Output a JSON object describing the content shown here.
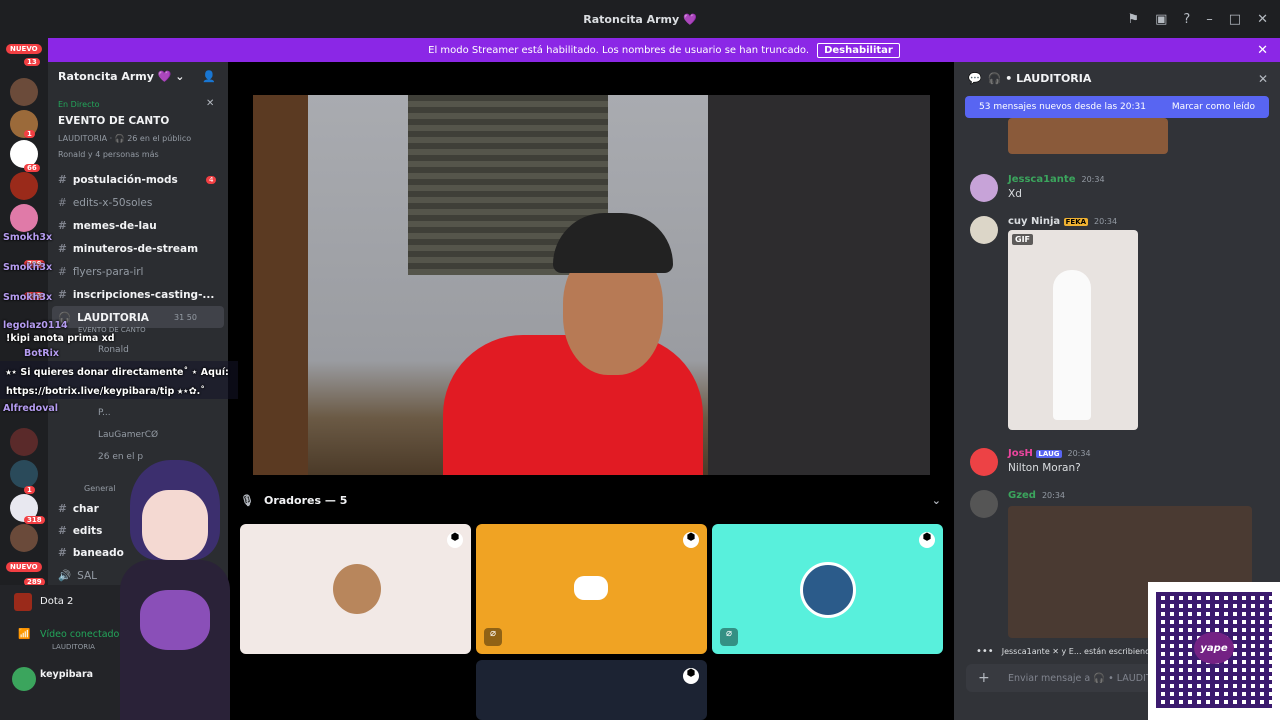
{
  "window": {
    "title": "Ratoncita Army 💜"
  },
  "banner": {
    "text": "El modo Streamer está habilitado. Los nombres de usuario se han truncado.",
    "button": "Deshabilitar"
  },
  "servers": {
    "new_top": "NUEVO",
    "badge_top": "13",
    "new_bottom": "NUEVO",
    "badges": [
      "1",
      "66",
      "799",
      "383",
      "1",
      "318",
      "289"
    ]
  },
  "sidebar": {
    "server_name": "Ratoncita Army 💜",
    "event": {
      "live": "En Directo",
      "name": "EVENTO DE CANTO",
      "info": "LAUDITORIA · 🎧 26 en el público",
      "people": "Ronald y 4 personas más"
    },
    "channels": [
      {
        "name": "postulación-mods",
        "badge": "4"
      },
      {
        "name": "edits-x-50soles"
      },
      {
        "name": "memes-de-lau"
      },
      {
        "name": "minuteros-de-stream"
      },
      {
        "name": "flyers-para-irl"
      },
      {
        "name": "inscripciones-casting-..."
      },
      {
        "name": "LAUDITORIA",
        "meta": "31  50"
      }
    ],
    "stage_label": "EVENTO DE CANTO",
    "stage_users": [
      "Ronald",
      "P...",
      "LauGamerCØ"
    ],
    "stage_audience": "26 en el p",
    "general": "General",
    "more_channels": [
      "char",
      "edits",
      "baneado",
      "SAL"
    ],
    "activity": "Dota 2",
    "voice_status": "Vídeo conectado",
    "voice_channel": "LAUDITORIA",
    "user": "keypibara"
  },
  "overlay": {
    "names": [
      "Smokh3x",
      "Smokh3x",
      "Smokh3x",
      "legolaz0114",
      "BotRix",
      "Alfredoval"
    ],
    "line1": "!kipi anota prima xd",
    "line2": "⭑⋆ Si quieres donar directamente˚ ⋆ Aquí:",
    "line3": "https://botrix.live/keypibara/tip ⭑⋆✿.˚"
  },
  "stage": {
    "speakers_header": "Oradores — 5"
  },
  "chat": {
    "header": "LAUDITORIA",
    "new_messages": "53 mensajes nuevos desde las 20:31",
    "mark_read": "Marcar como leído",
    "messages": [
      {
        "author": "Jessca1ante",
        "time": "20:34",
        "text": "Xd",
        "color": "#3ba55d"
      },
      {
        "author": "cuy Ninja",
        "tag": "FEKA",
        "time": "20:34",
        "text": "",
        "color": "#dbdee1"
      },
      {
        "author": "JosH",
        "tag": "LAUG",
        "time": "20:34",
        "text": "Nilton Moran?",
        "color": "#eb459e"
      },
      {
        "author": "Gzed",
        "time": "20:34",
        "text": "",
        "color": "#3ba55d"
      }
    ],
    "gif_label": "GIF",
    "typing": "Jessca1ante ✕ y E... están escribiendo...",
    "input_placeholder": "Enviar mensaje a 🎧 • LAUDIT"
  },
  "qr": {
    "brand": "yape"
  }
}
